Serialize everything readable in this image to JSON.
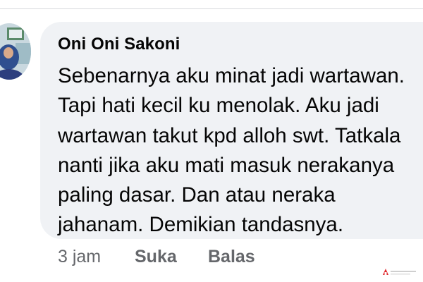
{
  "comment": {
    "author": "Oni Oni Sakoni",
    "lines": [
      "Sebenarnya aku minat jadi wartawan.",
      "Tapi hati kecil ku menolak. Aku jadi",
      "wartawan takut kpd alloh swt. Tatkala",
      "nanti jika aku mati masuk nerakanya",
      "paling dasar. Dan  atau neraka",
      "jahanam. Demikian tandasnya."
    ],
    "bubble_color": "#f0f2f5"
  },
  "actions": {
    "time": "3 jam",
    "like_label": "Suka",
    "reply_label": "Balas",
    "text_color": "#65676b"
  },
  "icons": {
    "avatar": "avatar",
    "watermark": "watermark-logo"
  }
}
